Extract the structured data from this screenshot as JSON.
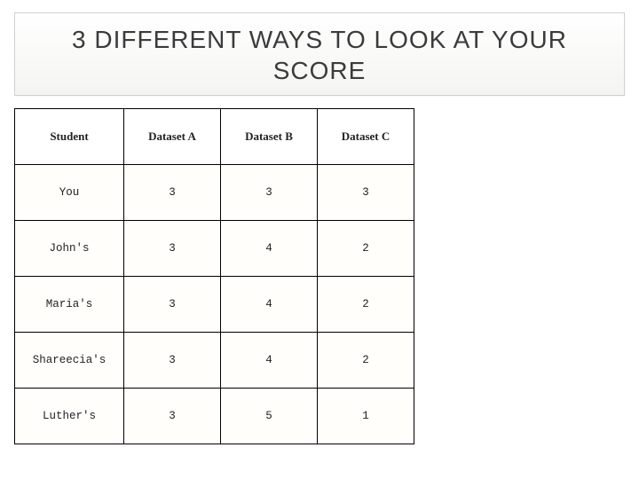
{
  "title": "3 DIFFERENT WAYS TO LOOK AT YOUR SCORE",
  "table": {
    "headers": [
      "Student",
      "Dataset A",
      "Dataset B",
      "Dataset C"
    ],
    "rows": [
      {
        "student": "You",
        "a": "3",
        "b": "3",
        "c": "3"
      },
      {
        "student": "John's",
        "a": "3",
        "b": "4",
        "c": "2"
      },
      {
        "student": "Maria's",
        "a": "3",
        "b": "4",
        "c": "2"
      },
      {
        "student": "Shareecia's",
        "a": "3",
        "b": "4",
        "c": "2"
      },
      {
        "student": "Luther's",
        "a": "3",
        "b": "5",
        "c": "1"
      }
    ]
  },
  "chart_data": {
    "type": "table",
    "title": "3 DIFFERENT WAYS TO LOOK AT YOUR SCORE",
    "categories": [
      "You",
      "John's",
      "Maria's",
      "Shareecia's",
      "Luther's"
    ],
    "series": [
      {
        "name": "Dataset A",
        "values": [
          3,
          3,
          3,
          3,
          3
        ]
      },
      {
        "name": "Dataset B",
        "values": [
          3,
          4,
          4,
          4,
          5
        ]
      },
      {
        "name": "Dataset C",
        "values": [
          3,
          2,
          2,
          2,
          1
        ]
      }
    ],
    "xlabel": "Student",
    "ylabel": "",
    "ylim": [
      1,
      5
    ]
  }
}
